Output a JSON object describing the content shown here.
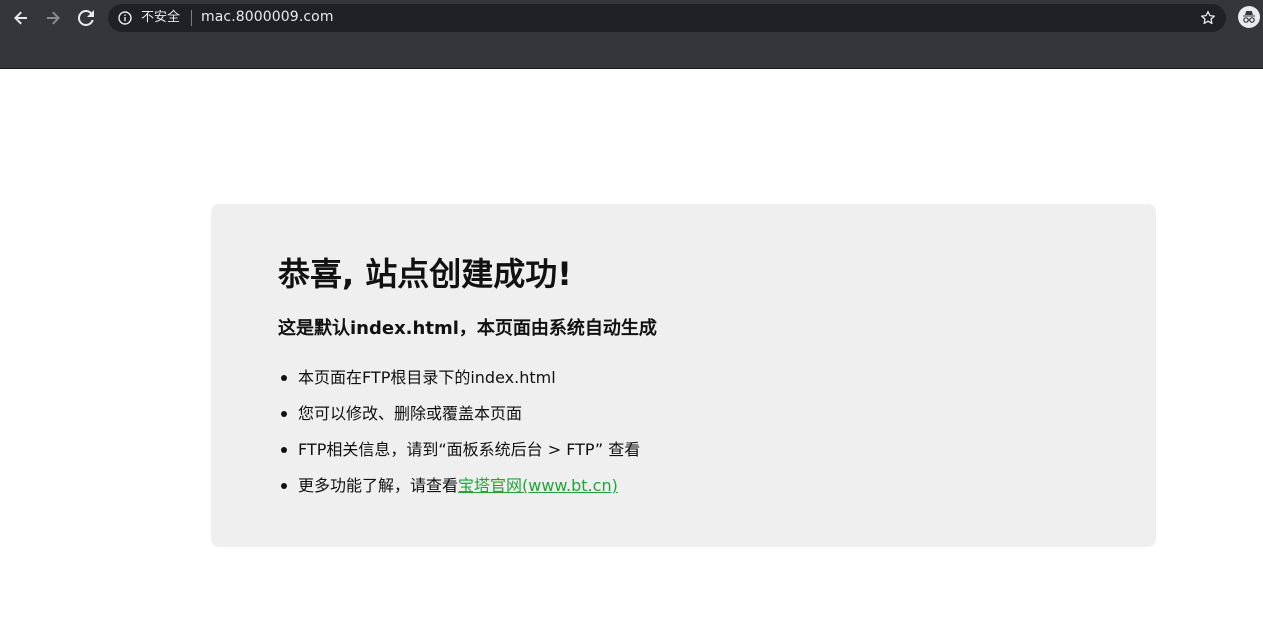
{
  "browser": {
    "security_label": "不安全",
    "url": "mac.8000009.com",
    "icons": {
      "back": "arrow-left-icon",
      "forward": "arrow-right-icon",
      "reload": "reload-icon",
      "info": "info-icon",
      "star": "star-icon",
      "incognito": "incognito-icon"
    }
  },
  "page": {
    "title": "恭喜, 站点创建成功!",
    "subtitle": "这是默认index.html，本页面由系统自动生成",
    "list": [
      {
        "text": "本页面在FTP根目录下的index.html"
      },
      {
        "text": "您可以修改、删除或覆盖本页面"
      },
      {
        "text": "FTP相关信息，请到“面板系统后台 > FTP” 查看"
      },
      {
        "text": "更多功能了解，请查看",
        "link_text": "宝塔官网(www.bt.cn)"
      }
    ],
    "link_color": "#20a53a",
    "card_background": "#efefef"
  }
}
